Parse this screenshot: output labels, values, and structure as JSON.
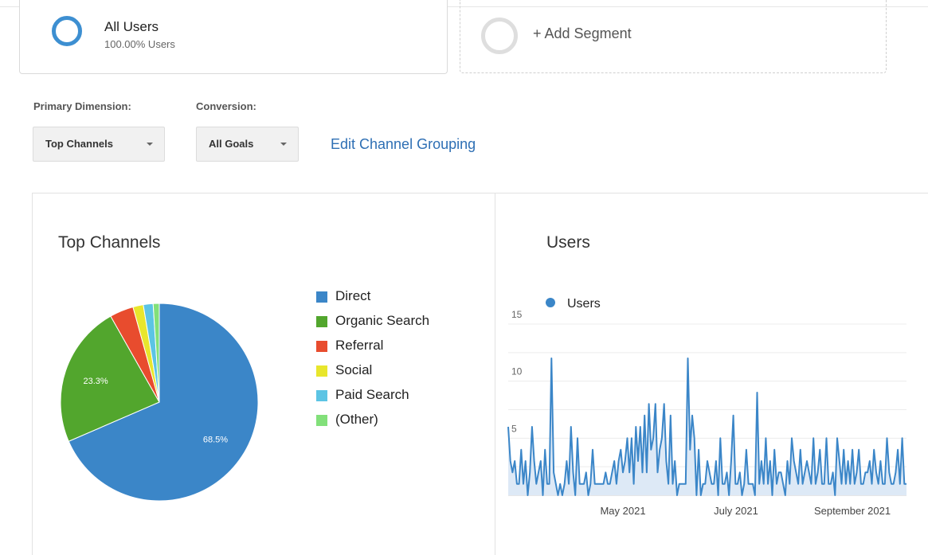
{
  "segments": {
    "active": {
      "name": "All Users",
      "subtitle": "100.00% Users"
    },
    "add_label": "+ Add Segment"
  },
  "controls": {
    "primary_dimension_label": "Primary Dimension:",
    "primary_dimension_value": "Top Channels",
    "conversion_label": "Conversion:",
    "conversion_value": "All Goals",
    "edit_link": "Edit Channel Grouping"
  },
  "colors": {
    "accent": "#3d8fd1",
    "link": "#2e6fb4",
    "direct": "#3b86c8",
    "organic": "#52a62d",
    "referral": "#e84c2e",
    "social": "#e8e62c",
    "paid": "#5cc4e4",
    "other": "#82e07a"
  },
  "chart_data": [
    {
      "type": "pie",
      "title": "Top Channels",
      "labels": [
        "Direct",
        "Organic Search",
        "Referral",
        "Social",
        "Paid Search",
        "(Other)"
      ],
      "values": [
        68.5,
        23.3,
        3.9,
        1.7,
        1.6,
        1.0
      ],
      "colors": [
        "#3b86c8",
        "#52a62d",
        "#e84c2e",
        "#e8e62c",
        "#5cc4e4",
        "#82e07a"
      ],
      "slice_labels": [
        "68.5%",
        "23.3%",
        "",
        "",
        "",
        ""
      ],
      "legend_position": "right"
    },
    {
      "type": "area",
      "title": "Users",
      "series": [
        {
          "name": "Users",
          "values": [
            6,
            3,
            2,
            3,
            1,
            1,
            4,
            1,
            3,
            0,
            2,
            6,
            3,
            1,
            2,
            3,
            0,
            4,
            1,
            1,
            12,
            2,
            1,
            0,
            1,
            0,
            1,
            3,
            1,
            6,
            2,
            0,
            5,
            1,
            1,
            1,
            2,
            0,
            1,
            4,
            1,
            1,
            1,
            1,
            1,
            2,
            1,
            1,
            2,
            3,
            1,
            3,
            4,
            2,
            3,
            5,
            2,
            5,
            1,
            6,
            3,
            6,
            2,
            7,
            2,
            8,
            4,
            5,
            8,
            2,
            4,
            5,
            8,
            3,
            1,
            7,
            1,
            3,
            0,
            1,
            1,
            1,
            1,
            12,
            4,
            7,
            5,
            0,
            4,
            0,
            1,
            1,
            3,
            2,
            1,
            1,
            3,
            0,
            5,
            1,
            1,
            2,
            0,
            3,
            7,
            1,
            1,
            2,
            0,
            1,
            4,
            1,
            1,
            1,
            0,
            9,
            1,
            3,
            1,
            5,
            1,
            3,
            0,
            4,
            1,
            2,
            2,
            1,
            0,
            3,
            1,
            5,
            3,
            2,
            1,
            4,
            1,
            2,
            3,
            2,
            1,
            5,
            1,
            2,
            4,
            1,
            1,
            5,
            1,
            1,
            2,
            0,
            5,
            3,
            1,
            4,
            1,
            3,
            1,
            4,
            1,
            2,
            4,
            1,
            1,
            2,
            2,
            3,
            1,
            4,
            2,
            1,
            3,
            1,
            1,
            5,
            2,
            1,
            1,
            2,
            4,
            1,
            5,
            1,
            1
          ]
        }
      ],
      "x_tick_labels": [
        "May 2021",
        "July 2021",
        "September 2021"
      ],
      "y_ticks": [
        5,
        10,
        15
      ],
      "ylim": [
        0,
        15
      ],
      "grid": true,
      "legend_position": "top-left"
    }
  ]
}
